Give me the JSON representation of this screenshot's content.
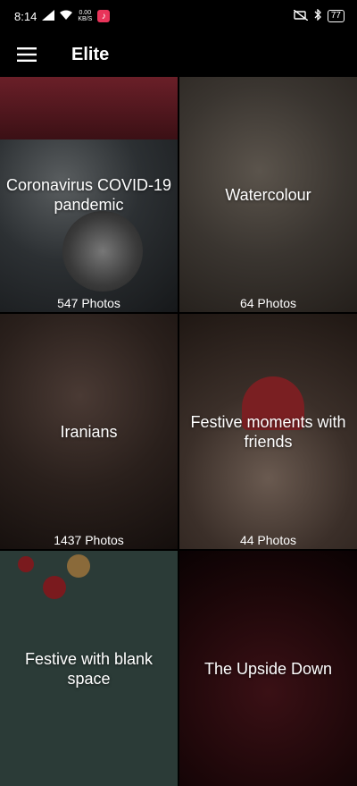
{
  "status_bar": {
    "time": "8:14",
    "net_speed_value": "0.00",
    "net_speed_unit": "KB/S",
    "battery": "77"
  },
  "app_bar": {
    "title": "Elite"
  },
  "albums": [
    {
      "title": "Coronavirus COVID-19 pandemic",
      "count": "547 Photos"
    },
    {
      "title": "Watercolour",
      "count": "64 Photos"
    },
    {
      "title": "Iranians",
      "count": "1437 Photos"
    },
    {
      "title": "Festive moments with friends",
      "count": "44 Photos"
    },
    {
      "title": "Festive with blank space",
      "count": ""
    },
    {
      "title": "The Upside Down",
      "count": ""
    }
  ]
}
